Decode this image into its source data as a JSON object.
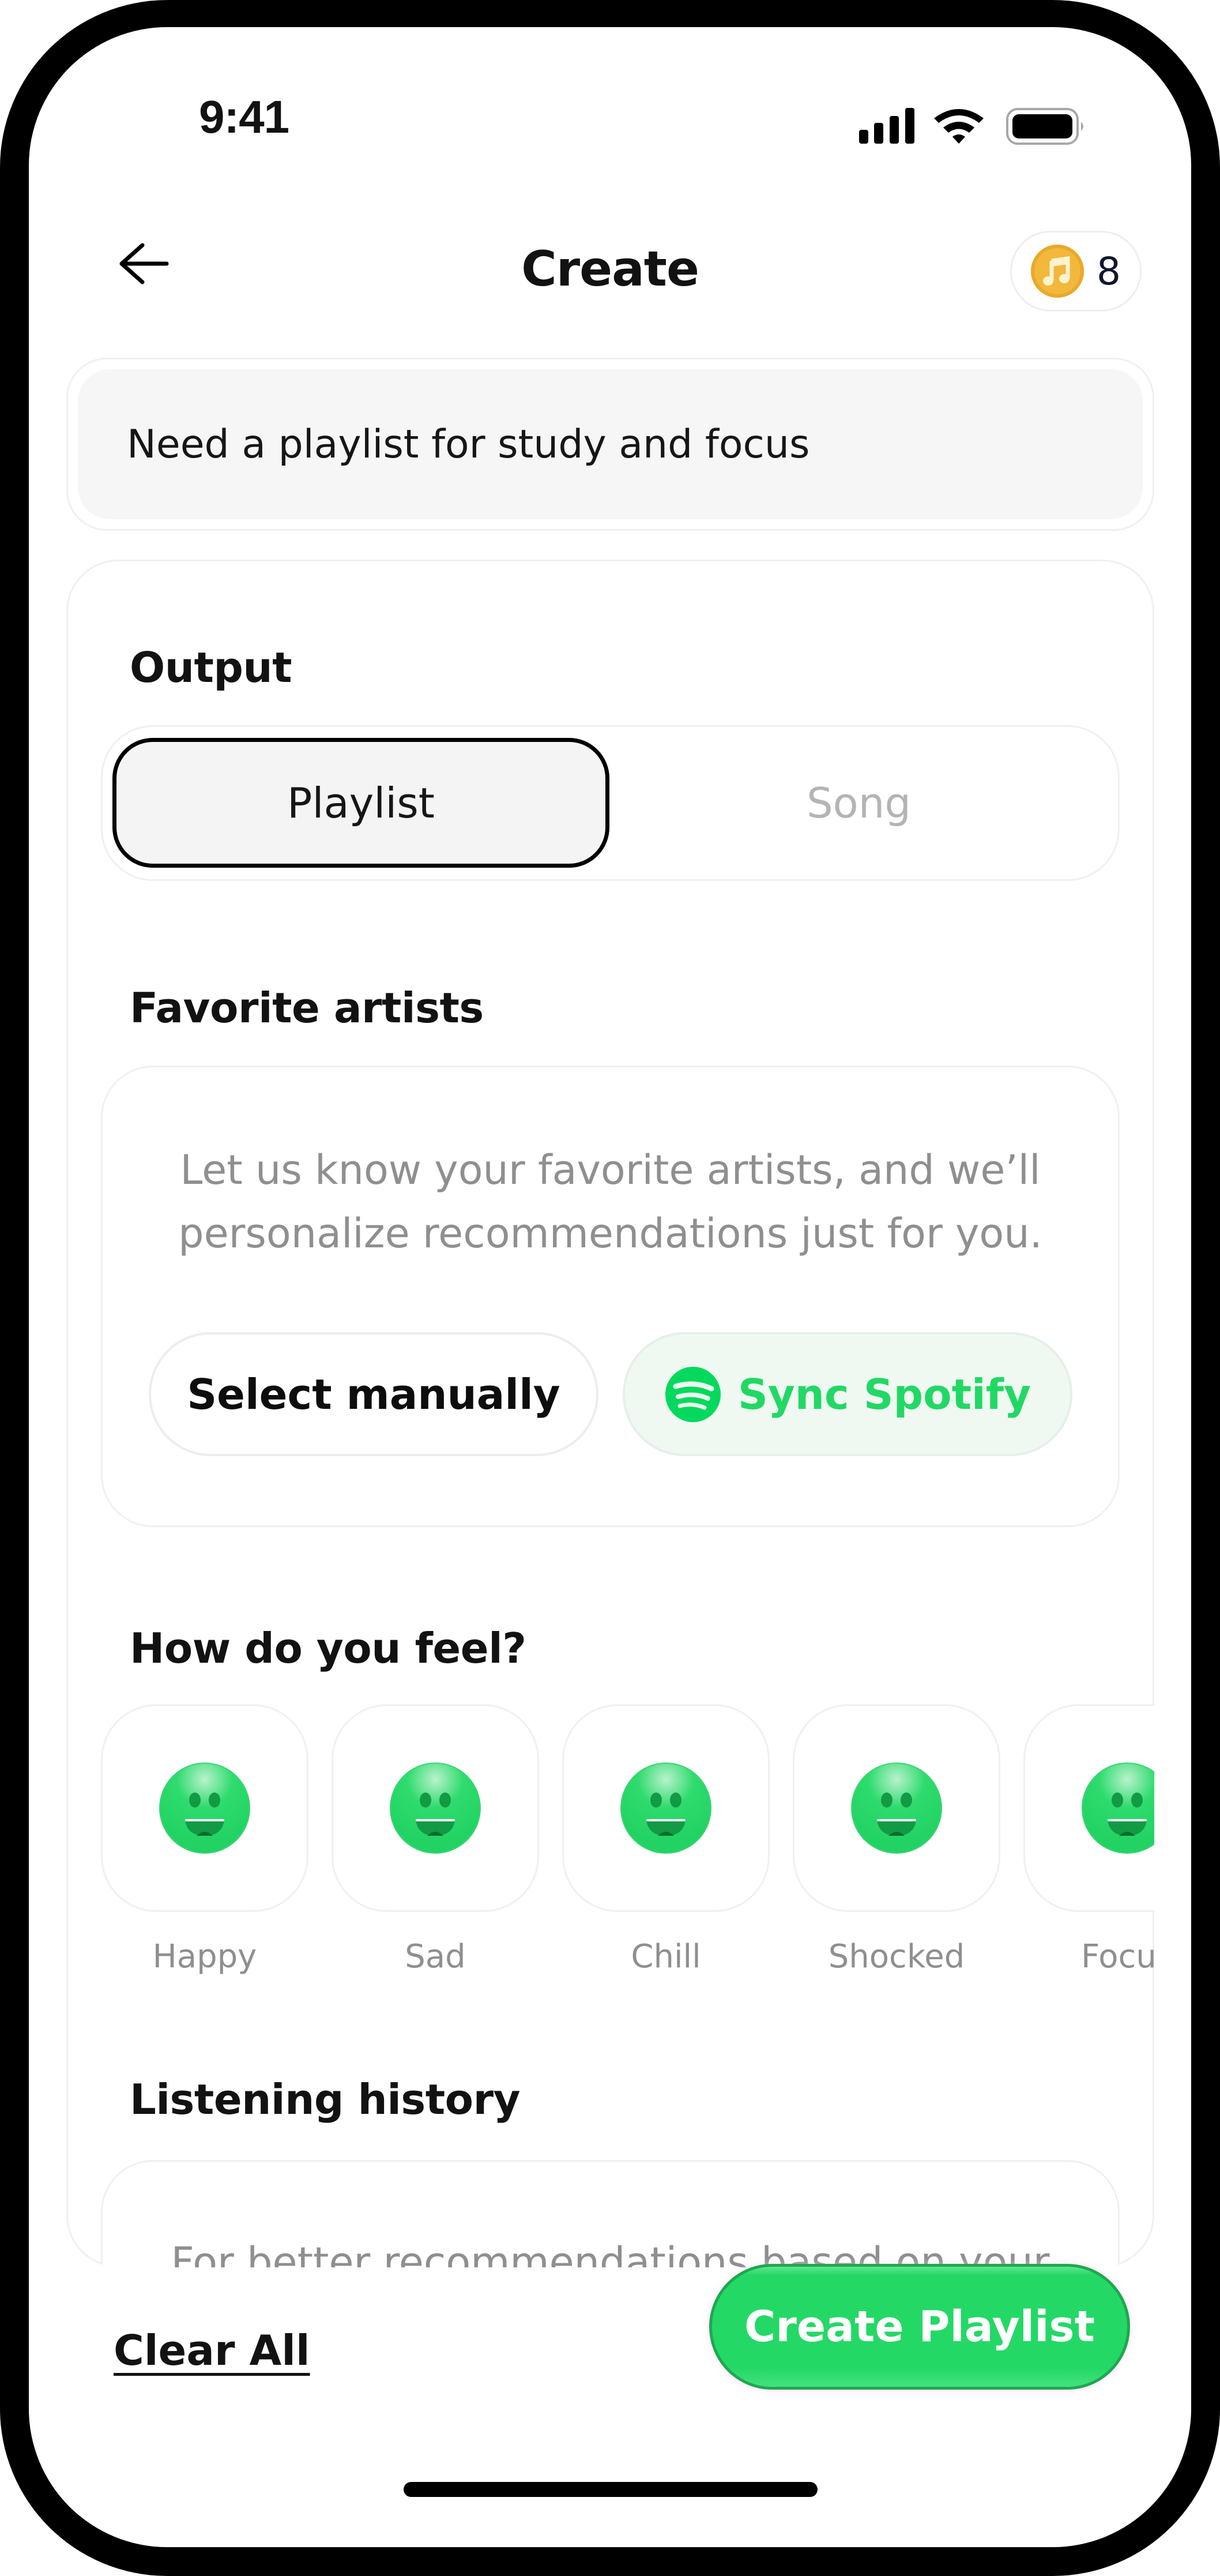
{
  "status_bar": {
    "time": "9:41",
    "icons": [
      "cellular-signal-icon",
      "wifi-icon",
      "battery-icon"
    ]
  },
  "header": {
    "back_icon": "arrow-left-icon",
    "title": "Create",
    "credits": {
      "icon": "music-note-coin-icon",
      "count": "8"
    }
  },
  "prompt": {
    "value": "Need a playlist for study and focus"
  },
  "output": {
    "label": "Output",
    "options": [
      {
        "label": "Playlist",
        "selected": true
      },
      {
        "label": "Song",
        "selected": false
      }
    ]
  },
  "favorite_artists": {
    "label": "Favorite artists",
    "description_line1": "Let us know your favorite artists, and we’ll",
    "description_line2": "personalize recommendations just for you.",
    "select_manually_label": "Select manually",
    "sync_spotify_label": "Sync Spotify",
    "spotify_icon": "spotify-logo-icon"
  },
  "feel": {
    "label": "How do you feel?",
    "moods": [
      {
        "label": "Happy",
        "icon": "smiley-face-icon"
      },
      {
        "label": "Sad",
        "icon": "smiley-face-icon"
      },
      {
        "label": "Chill",
        "icon": "smiley-face-icon"
      },
      {
        "label": "Shocked",
        "icon": "smiley-face-icon"
      },
      {
        "label": "Focus",
        "icon": "smiley-face-icon"
      }
    ]
  },
  "listening_history": {
    "label": "Listening history",
    "description_partial": "For better recommendations based on your"
  },
  "footer": {
    "clear_all_label": "Clear All",
    "create_label": "Create Playlist"
  },
  "colors": {
    "accent_green": "#24d866",
    "spotify_green": "#1ed760",
    "coin_gold": "#f2b83c",
    "muted_text": "#8f8f8f",
    "inactive_text": "#b4b4b4"
  }
}
